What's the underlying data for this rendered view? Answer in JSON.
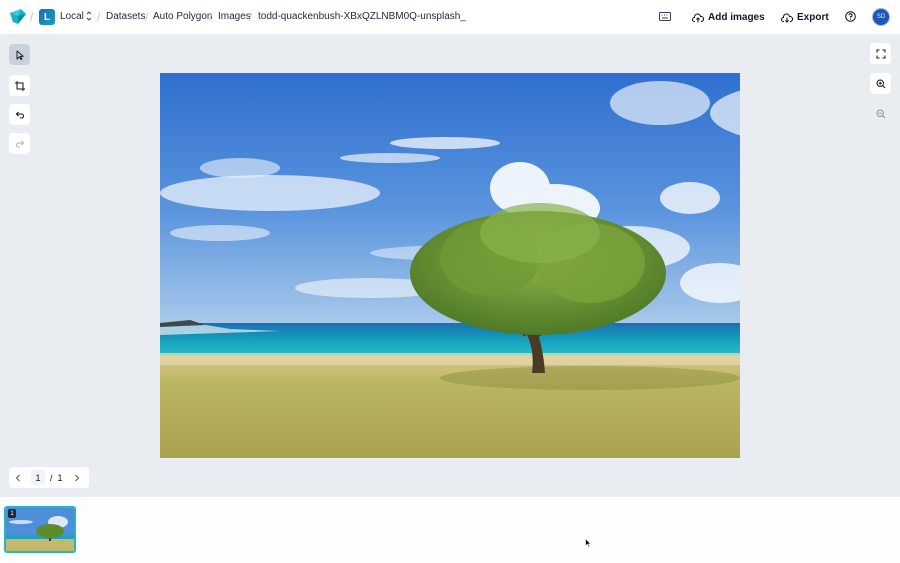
{
  "header": {
    "breadcrumb": {
      "workspace_initial": "L",
      "workspace": "Local",
      "items": [
        "Datasets",
        "Auto Polygon",
        "Images",
        "todd-quackenbush-XBxQZLNBM0Q-unsplash_"
      ]
    },
    "actions": {
      "add_images": "Add images",
      "export": "Export"
    },
    "avatar_initials": "SD"
  },
  "toolbar_left": {
    "tools": [
      "select-tool",
      "crop-tool",
      "undo",
      "redo"
    ],
    "active": "select-tool"
  },
  "toolbar_right": {
    "tools": [
      "fullscreen",
      "zoom-in",
      "zoom-out"
    ]
  },
  "pager": {
    "current": "1",
    "separator": "/",
    "total": "1"
  },
  "filmstrip": {
    "items": [
      {
        "number": "1",
        "selected": true
      }
    ]
  },
  "colors": {
    "accent": "#27b5c6",
    "canvas_bg": "#e9edf1",
    "active_tool": "#c9d1db",
    "avatar": "#1e56b3"
  }
}
